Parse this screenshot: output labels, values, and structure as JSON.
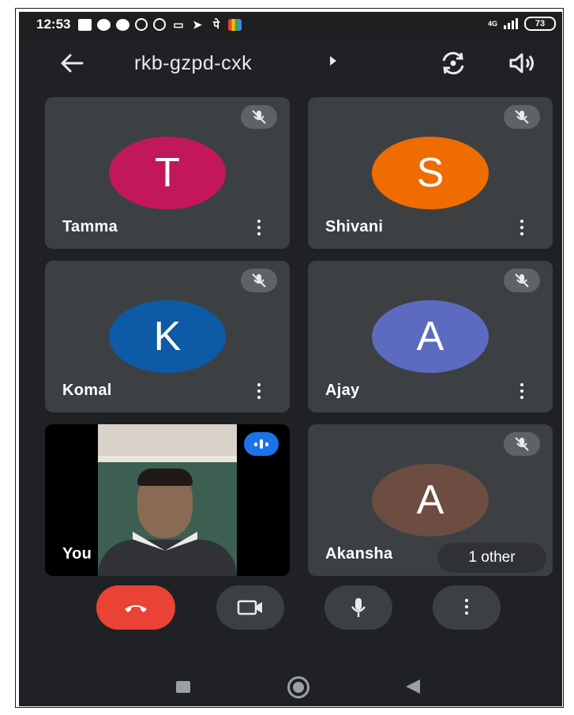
{
  "status_bar": {
    "time": "12:53",
    "network": "4G",
    "battery": "73",
    "notification_icons": [
      "message-icon",
      "chat-bubble-icon",
      "phone-icon",
      "whatsapp-icon",
      "vpn-icon",
      "video-icon",
      "telegram-icon",
      "hindi-keyboard-icon",
      "photos-icon"
    ],
    "hindi_glyph": "पे"
  },
  "header": {
    "meeting_code": "rkb-gzpd-cxk"
  },
  "participants": [
    {
      "name": "Tamma",
      "initial": "T",
      "color": "#c2185b",
      "muted": true
    },
    {
      "name": "Shivani",
      "initial": "S",
      "color": "#ef6c00",
      "muted": true
    },
    {
      "name": "Komal",
      "initial": "K",
      "color": "#0d5aa7",
      "muted": true
    },
    {
      "name": "Ajay",
      "initial": "A",
      "color": "#5c6bc0",
      "muted": true
    },
    {
      "name": "You",
      "initial": "",
      "color": "#000000",
      "muted": false,
      "speaking": true
    },
    {
      "name": "Akansha",
      "initial": "A",
      "color": "#6d4c41",
      "muted": true
    }
  ],
  "others_badge": "1 other",
  "controls": [
    "end-call",
    "camera",
    "microphone",
    "more-options"
  ],
  "colors": {
    "background": "#202124",
    "tile": "#3c4043",
    "end_call": "#ea4335",
    "speaking_indicator": "#1a73e8"
  }
}
